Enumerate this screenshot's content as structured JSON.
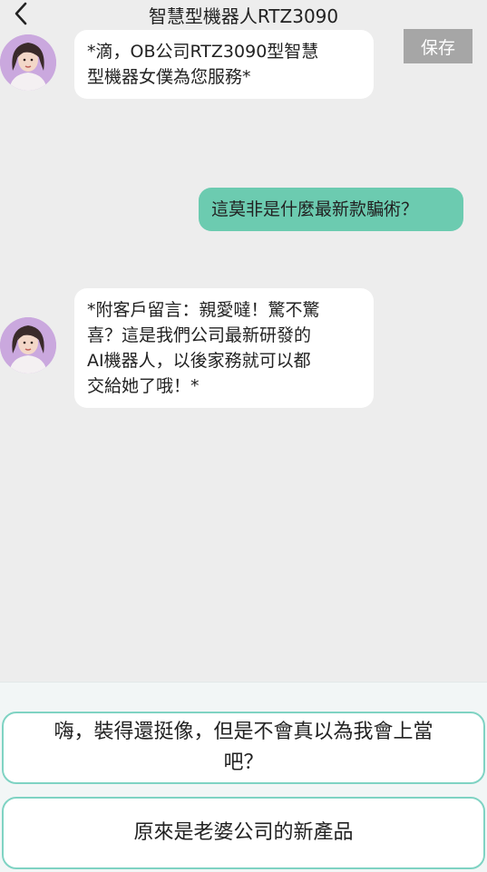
{
  "header": {
    "title": "智慧型機器人RTZ3090",
    "back_icon": "chevron-left-icon"
  },
  "save_button": {
    "label": "保存"
  },
  "messages": [
    {
      "sender": "robot",
      "text": "*滴，OB公司RTZ3090型智慧\n型機器女僕為您服務*"
    },
    {
      "sender": "user",
      "text": "這莫非是什麼最新款騙術？"
    },
    {
      "sender": "robot",
      "text": "*附客戶留言：親愛噠！驚不驚\n喜？這是我們公司最新研發的\nAI機器人，以後家務就可以都\n交給她了哦！*"
    }
  ],
  "choices": [
    {
      "label": "嗨，裝得還挺像，但是不會真以為我會上當\n吧？"
    },
    {
      "label": "原來是老婆公司的新產品"
    }
  ],
  "colors": {
    "background": "#ededed",
    "user_bubble": "#6ccbb0",
    "choice_border": "#7fd3c3",
    "save_button": "#a6a6a6"
  }
}
